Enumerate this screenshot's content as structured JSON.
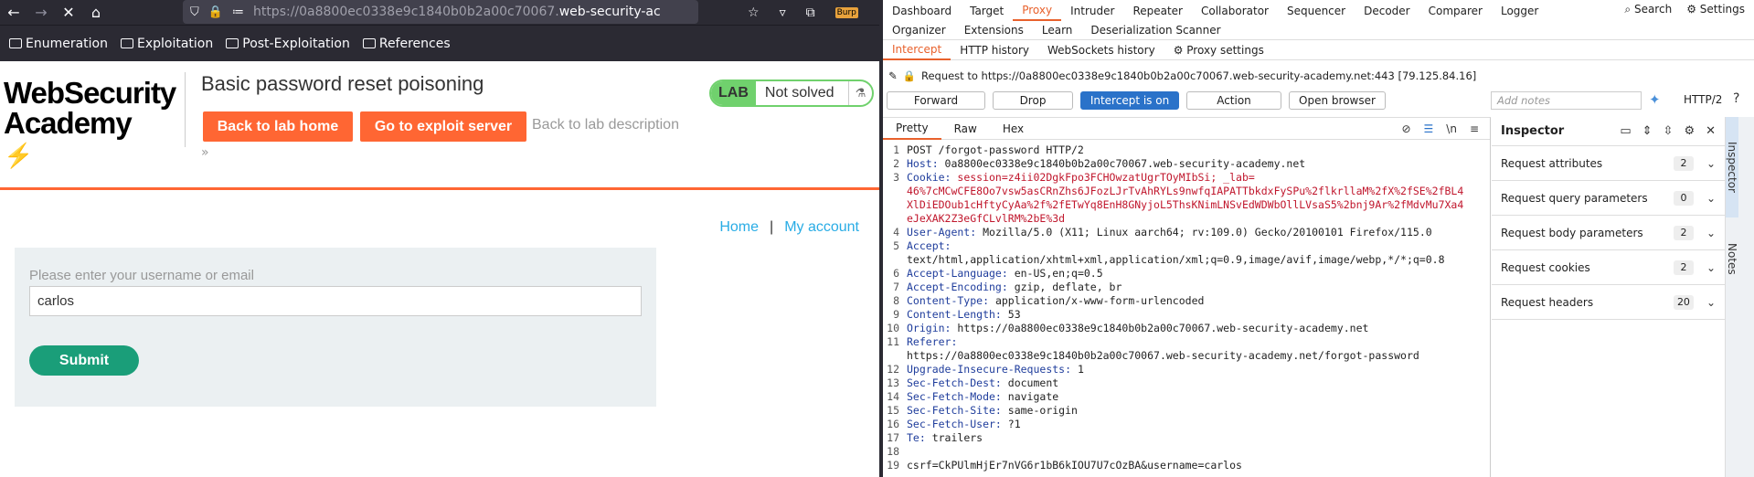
{
  "browser": {
    "url_prefix": "https://0a8800ec0338e9c1840b0b2a00c70067.",
    "url_domain": "web-security-ac",
    "bookmarks": [
      "Enumeration",
      "Exploitation",
      "Post-Exploitation",
      "References"
    ],
    "ext_label": "Burp"
  },
  "lab": {
    "logo_line1": "WebSecurity",
    "logo_line2": "Academy",
    "title": "Basic password reset poisoning",
    "back_home": "Back to lab home",
    "exploit": "Go to exploit server",
    "back_desc": "Back to lab description",
    "badge_lab": "LAB",
    "badge_status": "Not solved"
  },
  "page": {
    "home": "Home",
    "sep": "|",
    "account": "My account",
    "form_label": "Please enter your username or email",
    "username_value": "carlos",
    "submit": "Submit"
  },
  "burp": {
    "tabs": [
      "Dashboard",
      "Target",
      "Proxy",
      "Intruder",
      "Repeater",
      "Collaborator",
      "Sequencer",
      "Decoder",
      "Comparer",
      "Logger"
    ],
    "tabs2": [
      "Organizer",
      "Extensions",
      "Learn",
      "Deserialization Scanner"
    ],
    "search": "Search",
    "settings": "Settings",
    "subtabs": [
      "Intercept",
      "HTTP history",
      "WebSockets history",
      "Proxy settings"
    ],
    "request_line": "Request to https://0a8800ec0338e9c1840b0b2a00c70067.web-security-academy.net:443 [79.125.84.16]",
    "buttons": [
      "Forward",
      "Drop",
      "Intercept is on",
      "Action",
      "Open browser"
    ],
    "notes_placeholder": "Add notes",
    "http_version": "HTTP/2",
    "editor_tabs": [
      "Pretty",
      "Raw",
      "Hex"
    ],
    "inspector_title": "Inspector",
    "inspector_rows": [
      {
        "label": "Request attributes",
        "count": "2"
      },
      {
        "label": "Request query parameters",
        "count": "0"
      },
      {
        "label": "Request body parameters",
        "count": "2"
      },
      {
        "label": "Request cookies",
        "count": "2"
      },
      {
        "label": "Request headers",
        "count": "20"
      }
    ],
    "side_tabs": [
      "Inspector",
      "Notes"
    ],
    "code_lines": [
      {
        "n": "1",
        "k": "",
        "v": "POST /forgot-password HTTP/2"
      },
      {
        "n": "2",
        "k": "Host:",
        "v": " 0a8800ec0338e9c1840b0b2a00c70067.web-security-academy.net"
      },
      {
        "n": "3",
        "k": "Cookie:",
        "v": " session=z4ii02DgkFpo3FCHOwzatUgrTOyMIbSi; _lab="
      },
      {
        "n": "",
        "k": "",
        "v": "46%7cMCwCFE8Oo7vsw5asCRnZhs6JFozLJrTvAhRYLs9nwfqIAPATTbkdxFySPu%2flkrllaM%2fX%2fSE%2fBL4"
      },
      {
        "n": "",
        "k": "",
        "v": "XlDiEDOub1cHftyCyAa%2f%2fETwYq8EnH8GNyjoL5ThsKNimLNSvEdWDWbOllLVsaS5%2bnj9Ar%2fMdvMu7Xa4"
      },
      {
        "n": "",
        "k": "",
        "v": "eJeXAK2Z3eGfCLvlRM%2bE%3d"
      },
      {
        "n": "4",
        "k": "User-Agent:",
        "v": " Mozilla/5.0 (X11; Linux aarch64; rv:109.0) Gecko/20100101 Firefox/115.0"
      },
      {
        "n": "5",
        "k": "Accept:",
        "v": ""
      },
      {
        "n": "",
        "k": "",
        "v": "text/html,application/xhtml+xml,application/xml;q=0.9,image/avif,image/webp,*/*;q=0.8"
      },
      {
        "n": "6",
        "k": "Accept-Language:",
        "v": " en-US,en;q=0.5"
      },
      {
        "n": "7",
        "k": "Accept-Encoding:",
        "v": " gzip, deflate, br"
      },
      {
        "n": "8",
        "k": "Content-Type:",
        "v": " application/x-www-form-urlencoded"
      },
      {
        "n": "9",
        "k": "Content-Length:",
        "v": " 53"
      },
      {
        "n": "10",
        "k": "Origin:",
        "v": " https://0a8800ec0338e9c1840b0b2a00c70067.web-security-academy.net"
      },
      {
        "n": "11",
        "k": "Referer:",
        "v": ""
      },
      {
        "n": "",
        "k": "",
        "v": "https://0a8800ec0338e9c1840b0b2a00c70067.web-security-academy.net/forgot-password"
      },
      {
        "n": "12",
        "k": "Upgrade-Insecure-Requests:",
        "v": " 1"
      },
      {
        "n": "13",
        "k": "Sec-Fetch-Dest:",
        "v": " document"
      },
      {
        "n": "14",
        "k": "Sec-Fetch-Mode:",
        "v": " navigate"
      },
      {
        "n": "15",
        "k": "Sec-Fetch-Site:",
        "v": " same-origin"
      },
      {
        "n": "16",
        "k": "Sec-Fetch-User:",
        "v": " ?1"
      },
      {
        "n": "17",
        "k": "Te:",
        "v": " trailers"
      },
      {
        "n": "18",
        "k": "",
        "v": ""
      },
      {
        "n": "19",
        "k": "",
        "v": "csrf=CkPUlmHjEr7nVG6r1bB6kIOU7U7cOzBA&username=carlos"
      }
    ]
  }
}
